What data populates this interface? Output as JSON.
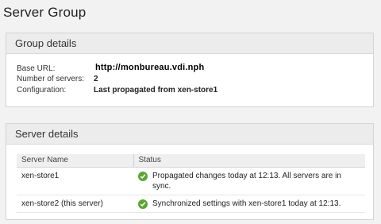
{
  "page": {
    "title": "Server Group"
  },
  "group_details": {
    "header": "Group details",
    "base_url_label": "Base URL:",
    "base_url_value": "http://monbureau.vdi.nph",
    "num_servers_label": "Number of servers:",
    "num_servers_value": "2",
    "configuration_label": "Configuration:",
    "configuration_value": "Last propagated from xen-store1"
  },
  "server_details": {
    "header": "Server details",
    "columns": {
      "name": "Server Name",
      "status": "Status"
    },
    "rows": [
      {
        "name": "xen-store1",
        "status": "Propagated changes today at 12:13. All servers are in sync.",
        "status_icon": "check-circle-icon"
      },
      {
        "name": "xen-store2 (this server)",
        "status": "Synchronized settings with xen-store1 today at 12:13.",
        "status_icon": "check-circle-icon"
      }
    ]
  },
  "colors": {
    "ok_green": "#5aa632",
    "header_bg": "#ececec",
    "page_bg": "#f2f2f2"
  }
}
